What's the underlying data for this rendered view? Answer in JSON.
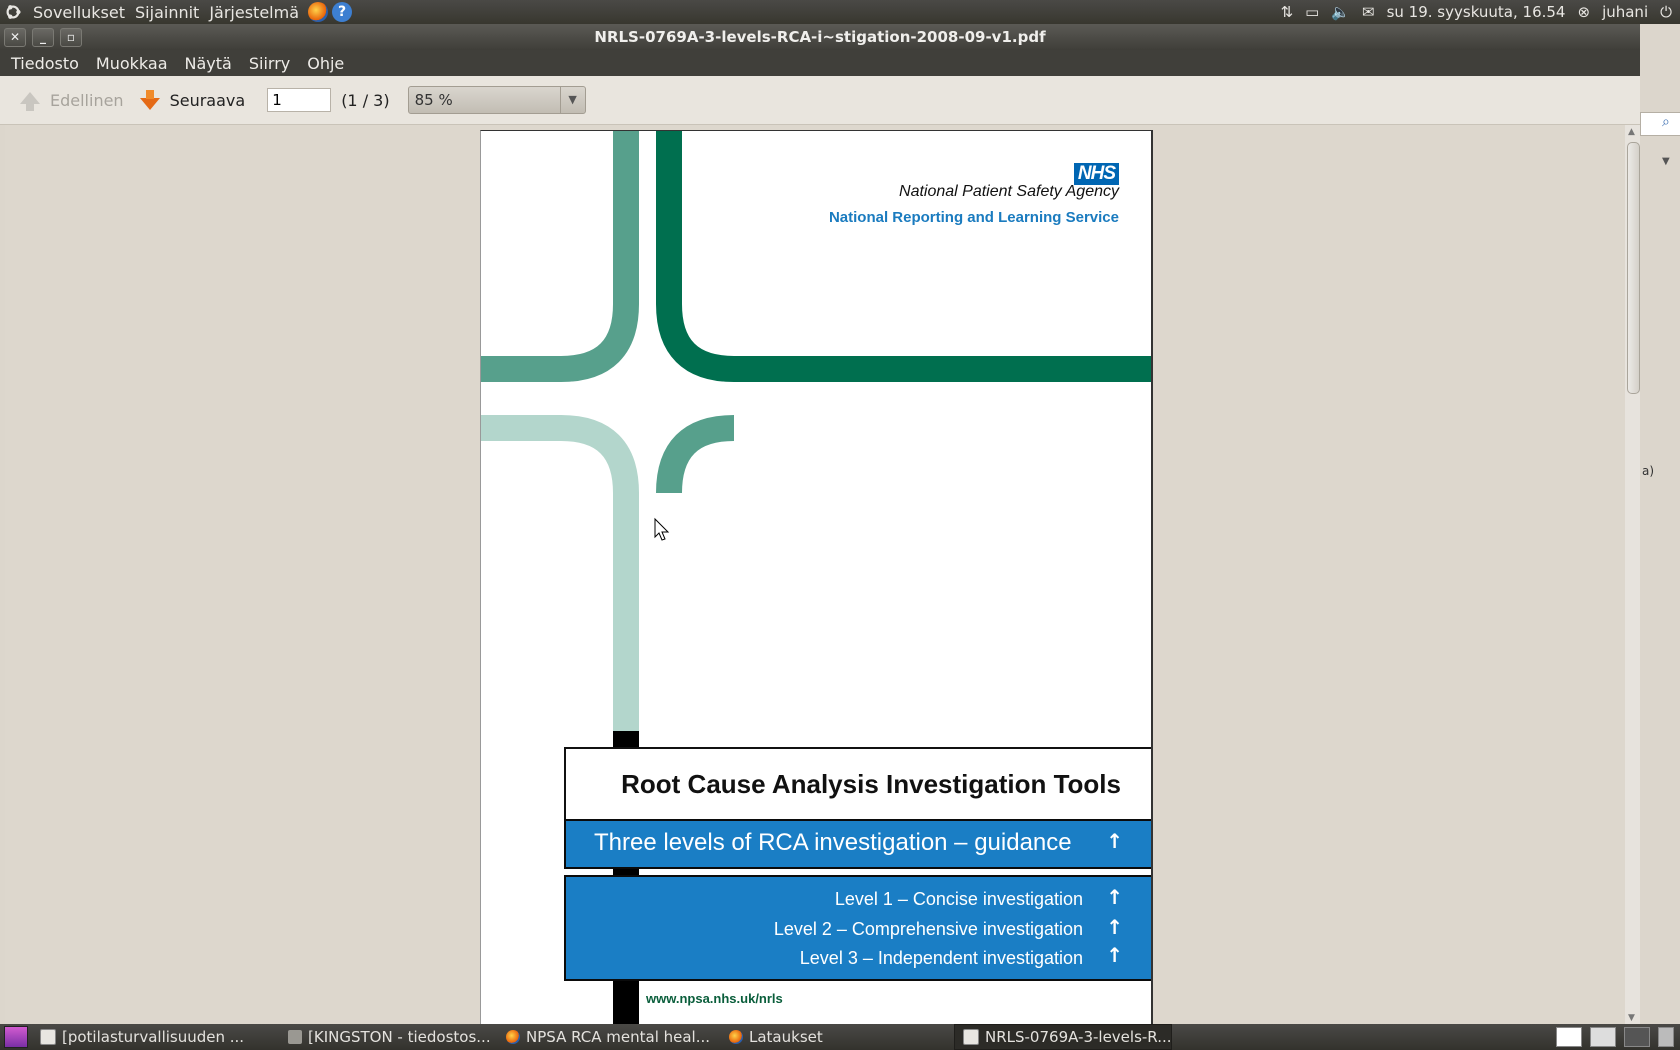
{
  "top_panel": {
    "menus": [
      "Sovellukset",
      "Sijainnit",
      "Järjestelmä"
    ],
    "clock": "su 19. syyskuuta, 16.54",
    "user": "juhani"
  },
  "window": {
    "title": "NRLS-0769A-3-levels-RCA-i~stigation-2008-09-v1.pdf",
    "menus": [
      "Tiedosto",
      "Muokkaa",
      "Näytä",
      "Siirry",
      "Ohje"
    ]
  },
  "toolbar": {
    "prev_label": "Edellinen",
    "next_label": "Seuraava",
    "page_value": "1",
    "page_count": "(1 / 3)",
    "zoom": "85 %"
  },
  "document": {
    "nhs_logo": "NHS",
    "agency": "National Patient Safety Agency",
    "service": "National Reporting and Learning Service",
    "title": "Root Cause Analysis Investigation Tools",
    "subtitle": "Three levels of RCA investigation – guidance",
    "levels": [
      "Level 1 – Concise investigation",
      "Level 2 – Comprehensive investigation",
      "Level 3 – Independent investigation"
    ],
    "url": "www.npsa.nhs.uk/nrls"
  },
  "side_fragment_text": "a)",
  "taskbar": {
    "tasks": [
      {
        "label": "[potilasturvallisuuden ...",
        "icon": "document-icon"
      },
      {
        "label": "[KINGSTON - tiedostos...",
        "icon": "folder-icon"
      },
      {
        "label": "NPSA RCA mental heal...",
        "icon": "firefox-icon"
      },
      {
        "label": "Lataukset",
        "icon": "firefox-icon"
      },
      {
        "label": "NRLS-0769A-3-levels-R...",
        "icon": "pdf-document-icon"
      }
    ]
  },
  "colors": {
    "nhs_blue": "#1a7ec5",
    "green_dark": "#006f4f",
    "green_mid": "#57a08c",
    "green_light": "#b3d6cc"
  }
}
